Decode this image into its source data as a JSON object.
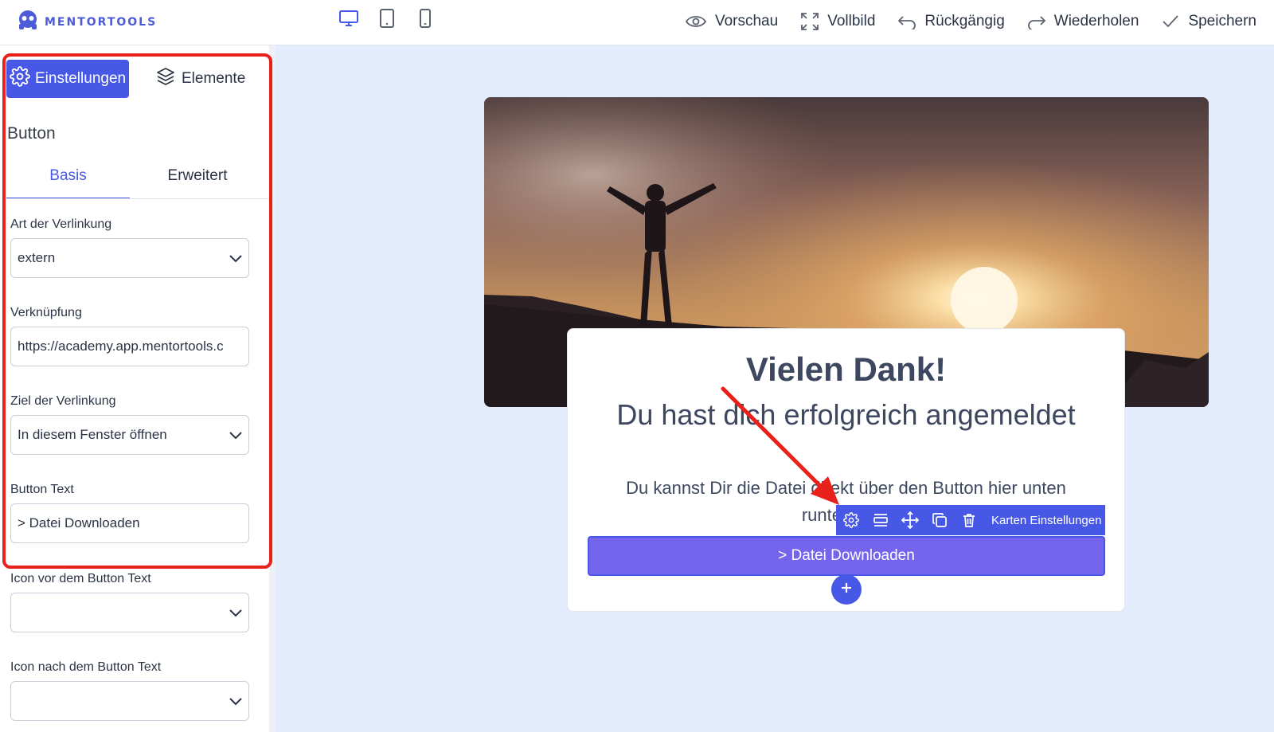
{
  "app": {
    "logo_text": "MENTORTOOLS"
  },
  "devices": [
    "desktop-icon",
    "tablet-icon",
    "mobile-icon"
  ],
  "header_actions": {
    "preview": "Vorschau",
    "fullscreen": "Vollbild",
    "undo": "Rückgängig",
    "redo": "Wiederholen",
    "save": "Speichern"
  },
  "sidebar": {
    "tabs": {
      "settings": "Einstellungen",
      "elements": "Elemente"
    },
    "section_title": "Button",
    "subtabs": {
      "basic": "Basis",
      "advanced": "Erweitert"
    },
    "fields": {
      "link_type_label": "Art der Verlinkung",
      "link_type_value": "extern",
      "link_label": "Verknüpfung",
      "link_value": "https://academy.app.mentortools.c",
      "target_label": "Ziel der Verlinkung",
      "target_value": "In diesem Fenster öffnen",
      "button_text_label": "Button Text",
      "button_text_value": "> Datei Downloaden",
      "icon_before_label": "Icon vor dem Button Text",
      "icon_before_value": "",
      "icon_after_label": "Icon nach dem Button Text",
      "icon_after_value": ""
    }
  },
  "card": {
    "title": "Vielen Dank!",
    "subtitle": "Du hast dich erfolgreich angemeldet",
    "text": "Du kannst Dir die Datei direkt über den Button hier unten runterladen",
    "button": "> Datei Downloaden",
    "toolbar_label": "Karten Einstellungen",
    "add_symbol": "+"
  },
  "colors": {
    "accent": "#4758e6",
    "button": "#7465ec",
    "canvas": "#e3ecfd",
    "highlight": "#e8211b"
  }
}
